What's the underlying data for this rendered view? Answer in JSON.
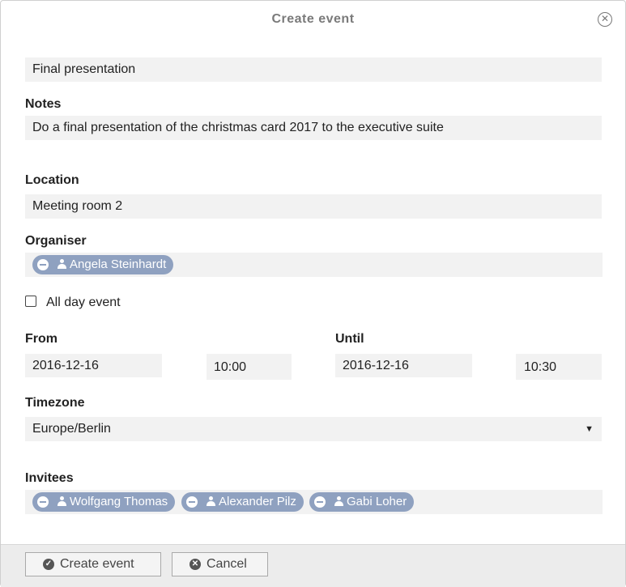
{
  "dialog": {
    "title": "Create event",
    "close_icon": "close-circle-icon"
  },
  "form": {
    "title_value": "Final presentation",
    "notes_label": "Notes",
    "notes_value": "Do a final presentation of the christmas card 2017 to the executive suite",
    "location_label": "Location",
    "location_value": "Meeting room 2",
    "organiser_label": "Organiser",
    "organiser": {
      "name": "Angela Steinhardt"
    },
    "all_day_label": "All day event",
    "all_day_checked": false,
    "from_label": "From",
    "from_date": "2016-12-16",
    "from_time": "10:00",
    "until_label": "Until",
    "until_date": "2016-12-16",
    "until_time": "10:30",
    "timezone_label": "Timezone",
    "timezone_value": "Europe/Berlin",
    "invitees_label": "Invitees",
    "invitees": [
      {
        "name": "Wolfgang Thomas"
      },
      {
        "name": "Alexander Pilz"
      },
      {
        "name": "Gabi Loher"
      }
    ]
  },
  "footer": {
    "create_label": "Create event",
    "cancel_label": "Cancel"
  },
  "colors": {
    "chip": "#8fa1c0",
    "field_bg": "#f2f2f2",
    "footer_bg": "#ececec"
  }
}
